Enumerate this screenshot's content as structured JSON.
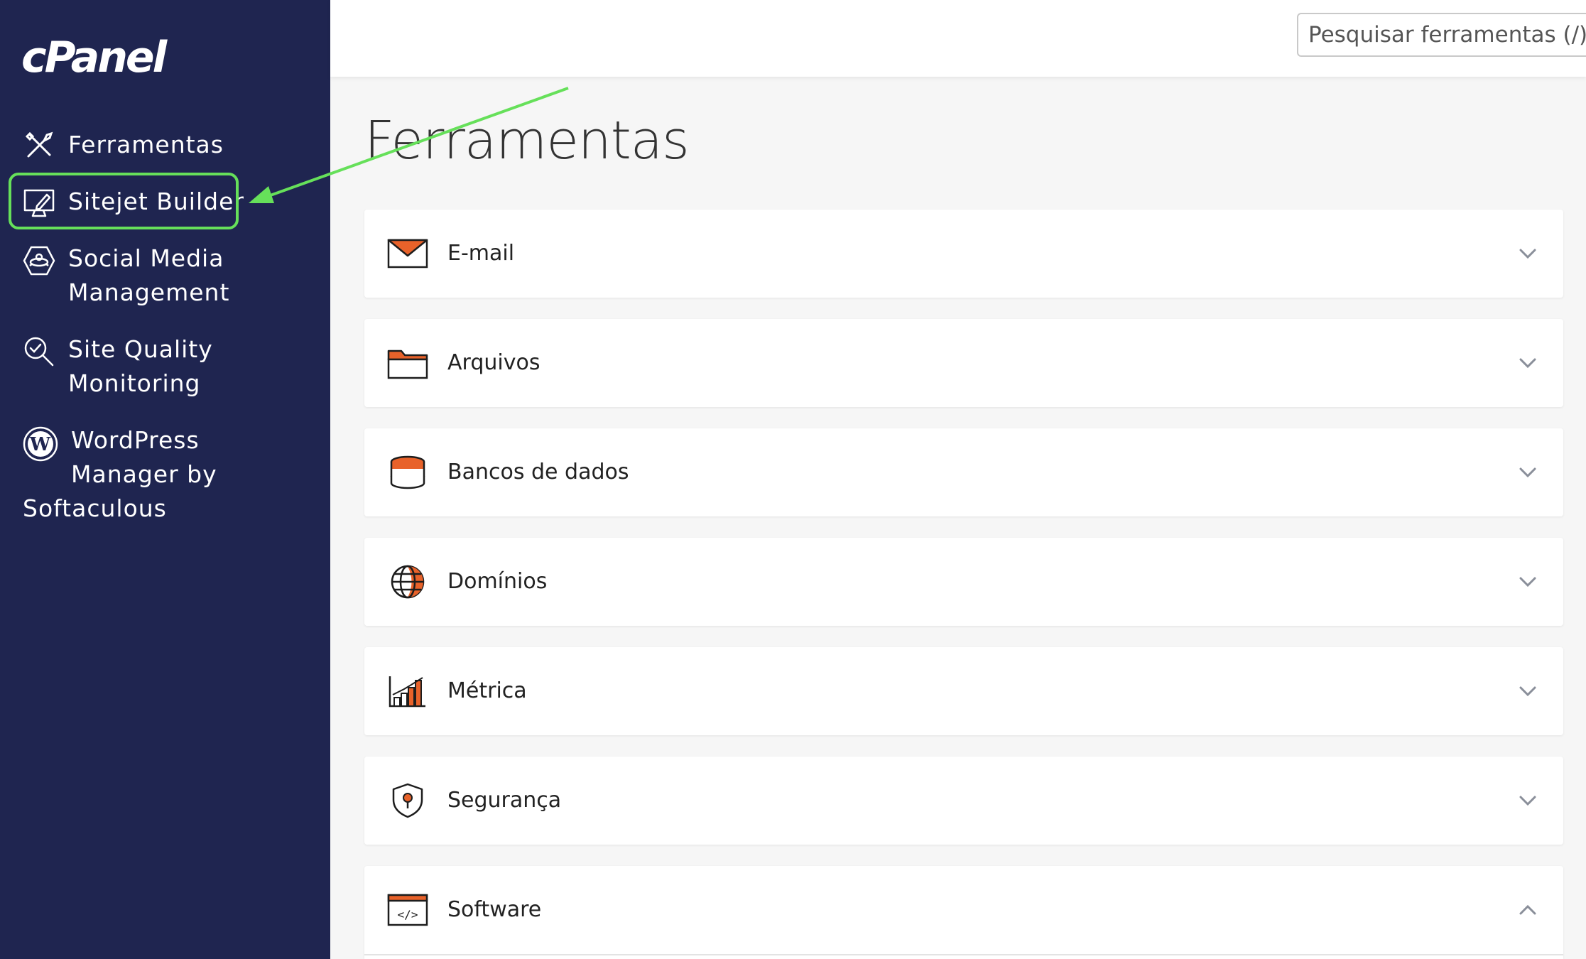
{
  "brand": {
    "logo_text": "cPanel"
  },
  "sidebar": {
    "items": [
      {
        "icon": "tools-icon",
        "lines": [
          "Ferramentas"
        ]
      },
      {
        "icon": "monitor-pen-icon",
        "lines": [
          "Sitejet Builder"
        ]
      },
      {
        "icon": "social-media-icon",
        "lines": [
          "Social Media",
          "Management"
        ]
      },
      {
        "icon": "magnifier-check-icon",
        "lines": [
          "Site Quality",
          "Monitoring"
        ]
      },
      {
        "icon": "wordpress-icon",
        "lines": [
          "WordPress",
          "Manager by",
          "Softaculous"
        ]
      }
    ]
  },
  "search": {
    "placeholder": "Pesquisar ferramentas (/)"
  },
  "main": {
    "title": "Ferramentas",
    "sections": [
      {
        "label": "E-mail",
        "icon": "email-icon",
        "expanded": false
      },
      {
        "label": "Arquivos",
        "icon": "folder-icon",
        "expanded": false
      },
      {
        "label": "Bancos de dados",
        "icon": "database-icon",
        "expanded": false
      },
      {
        "label": "Domínios",
        "icon": "globe-icon",
        "expanded": false
      },
      {
        "label": "Métrica",
        "icon": "metrics-chart-icon",
        "expanded": false
      },
      {
        "label": "Segurança",
        "icon": "shield-icon",
        "expanded": false
      },
      {
        "label": "Software",
        "icon": "code-window-icon",
        "expanded": true
      }
    ]
  },
  "colors": {
    "sidebar_bg": "#1f2550",
    "accent_orange": "#e8622a",
    "highlight_green": "#66e05a",
    "icon_dark": "#1d1d1d"
  }
}
